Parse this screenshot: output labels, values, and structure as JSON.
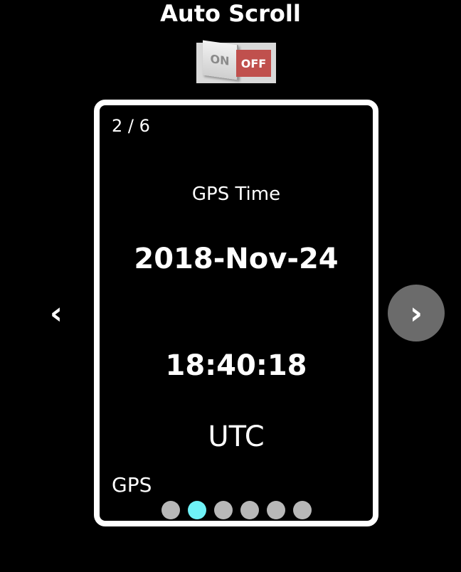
{
  "header": {
    "title": "Auto Scroll"
  },
  "auto_scroll_toggle": {
    "on_label": "ON",
    "off_label": "OFF",
    "state": "off"
  },
  "card": {
    "page_counter": "2 / 6",
    "label": "GPS Time",
    "date": "2018-Nov-24",
    "time": "18:40:18",
    "timezone": "UTC",
    "source": "GPS"
  },
  "pagination": {
    "total": 6,
    "active_index": 1
  },
  "navigation": {
    "prev_glyph": "‹",
    "next_glyph": "›"
  },
  "colors": {
    "background": "#000000",
    "card_border": "#ffffff",
    "toggle_off": "#c0504d",
    "dot_inactive": "#b8b8b8",
    "dot_active": "#6ff2f7",
    "next_button": "#6b6b6b"
  },
  "icons": {
    "prev": "chevron-left-icon",
    "next": "chevron-right-icon"
  }
}
